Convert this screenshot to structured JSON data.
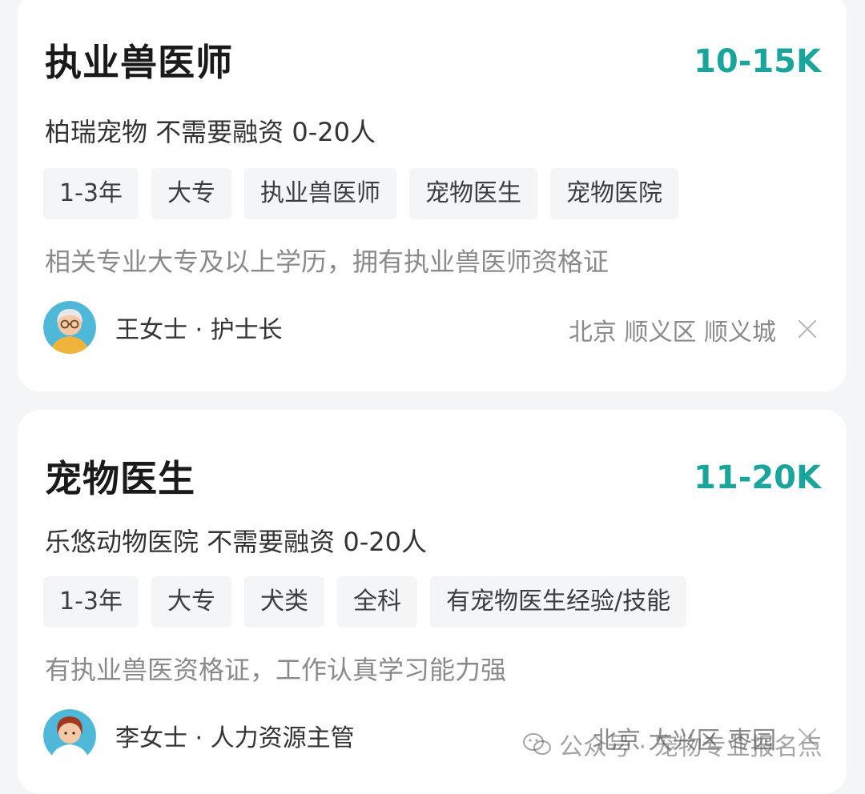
{
  "jobs": [
    {
      "title": "执业兽医师",
      "salary": "10-15K",
      "company": "柏瑞宠物 不需要融资 0-20人",
      "tags": [
        "1-3年",
        "大专",
        "执业兽医师",
        "宠物医生",
        "宠物医院"
      ],
      "description": "相关专业大专及以上学历，拥有执业兽医师资格证",
      "recruiter": "王女士 · 护士长",
      "location": "北京 顺义区 顺义城"
    },
    {
      "title": "宠物医生",
      "salary": "11-20K",
      "company": "乐悠动物医院 不需要融资 0-20人",
      "tags": [
        "1-3年",
        "大专",
        "犬类",
        "全科",
        "有宠物医生经验/技能"
      ],
      "description": "有执业兽医资格证，工作认真学习能力强",
      "recruiter": "李女士 · 人力资源主管",
      "location": "北京 大兴区 枣园"
    }
  ],
  "watermark": "公众号 · 宠物专业报名点",
  "colors": {
    "salary": "#1aa59c",
    "background": "#f4f5f7",
    "card": "#ffffff",
    "avatar_bg": "#4fb8d9"
  },
  "icons": {
    "close": "close-icon",
    "avatar": "avatar-icon",
    "watermark": "wechat-icon"
  }
}
